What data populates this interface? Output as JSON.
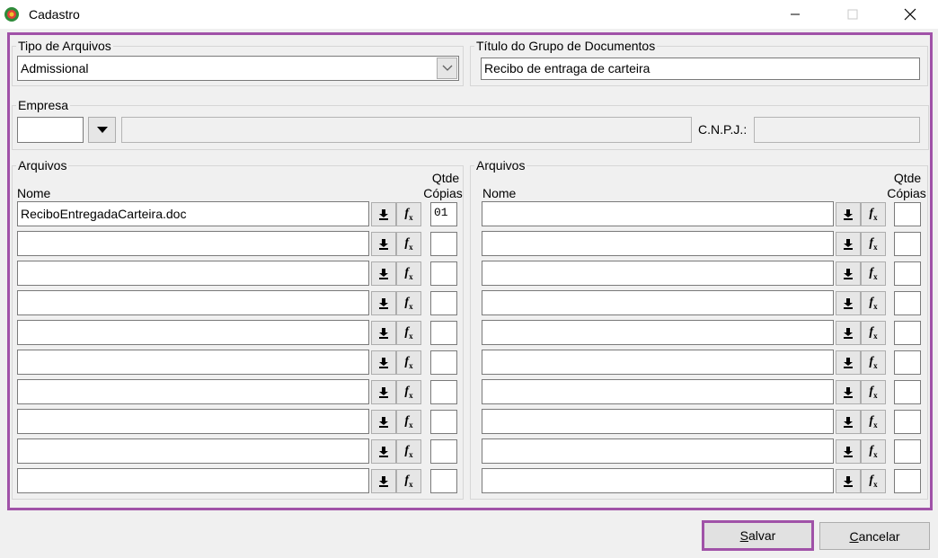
{
  "window": {
    "title": "Cadastro",
    "minimize_icon": "minimize-icon",
    "maximize_icon": "maximize-icon",
    "close_icon": "close-icon"
  },
  "tipo_arquivos": {
    "legend": "Tipo de Arquivos",
    "selected": "Admissional"
  },
  "titulo_grupo": {
    "legend": "Título do Grupo de Documentos",
    "value": "Recibo de entraga de carteira"
  },
  "empresa": {
    "legend": "Empresa",
    "code": "",
    "name": "",
    "cnpj_label": "C.N.P.J.:",
    "cnpj": ""
  },
  "arquivos_left": {
    "legend": "Arquivos",
    "col_name": "Nome",
    "col_qtde_1": "Qtde",
    "col_qtde_2": "Cópias",
    "rows": [
      {
        "name": "ReciboEntregadaCarteira.doc",
        "copies": "01"
      },
      {
        "name": "",
        "copies": ""
      },
      {
        "name": "",
        "copies": ""
      },
      {
        "name": "",
        "copies": ""
      },
      {
        "name": "",
        "copies": ""
      },
      {
        "name": "",
        "copies": ""
      },
      {
        "name": "",
        "copies": ""
      },
      {
        "name": "",
        "copies": ""
      },
      {
        "name": "",
        "copies": ""
      },
      {
        "name": "",
        "copies": ""
      }
    ]
  },
  "arquivos_right": {
    "legend": "Arquivos",
    "col_name": "Nome",
    "col_qtde_1": "Qtde",
    "col_qtde_2": "Cópias",
    "rows": [
      {
        "name": "",
        "copies": ""
      },
      {
        "name": "",
        "copies": ""
      },
      {
        "name": "",
        "copies": ""
      },
      {
        "name": "",
        "copies": ""
      },
      {
        "name": "",
        "copies": ""
      },
      {
        "name": "",
        "copies": ""
      },
      {
        "name": "",
        "copies": ""
      },
      {
        "name": "",
        "copies": ""
      },
      {
        "name": "",
        "copies": ""
      },
      {
        "name": "",
        "copies": ""
      }
    ]
  },
  "buttons": {
    "save_first": "S",
    "save_rest": "alvar",
    "cancel_first": "C",
    "cancel_rest": "ancelar"
  },
  "colors": {
    "highlight": "#a052a8"
  }
}
